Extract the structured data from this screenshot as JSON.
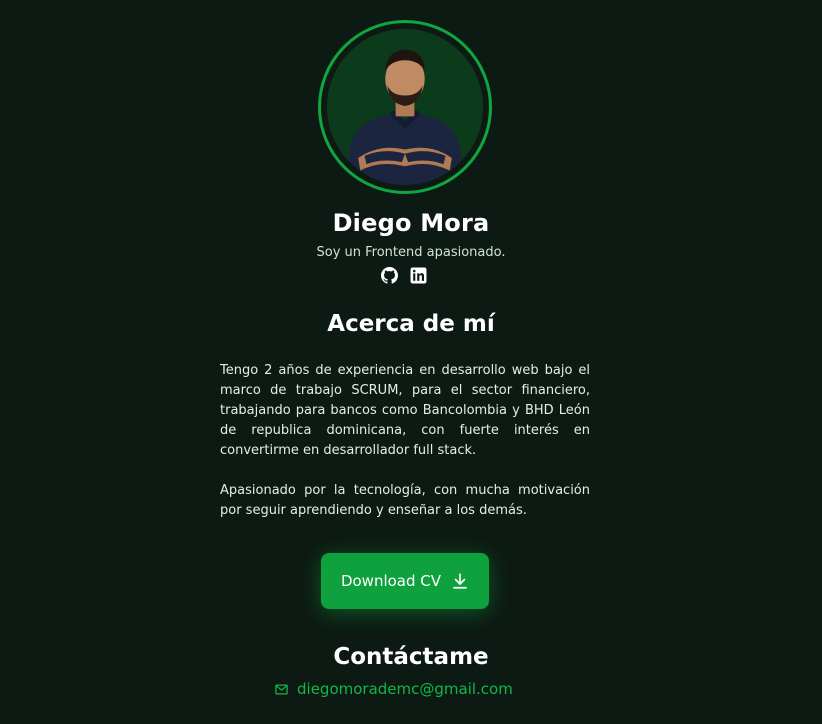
{
  "profile": {
    "name": "Diego Mora",
    "tagline": "Soy un Frontend apasionado.",
    "photo_alt": "Diego Mora"
  },
  "socials": [
    {
      "icon": "github-icon"
    },
    {
      "icon": "linkedin-icon"
    }
  ],
  "about": {
    "title": "Acerca de mí",
    "paragraphs": [
      "Tengo 2 años de experiencia en desarrollo web bajo el marco de trabajo SCRUM, para el sector financiero, trabajando para bancos como Bancolombia y BHD León de republica dominicana, con fuerte interés en convertirme en desarrollador full stack.",
      "Apasionado por la tecnología, con mucha motivación por seguir aprendiendo y enseñar a los demás."
    ]
  },
  "download": {
    "label": "Download CV",
    "icon": "download-icon"
  },
  "contact": {
    "title": "Contáctame",
    "email": "diegomorademc@gmail.com",
    "icon": "mail-icon"
  },
  "colors": {
    "background": "#0d1a13",
    "accent": "#0fa540",
    "accent_text": "#0fb847"
  }
}
